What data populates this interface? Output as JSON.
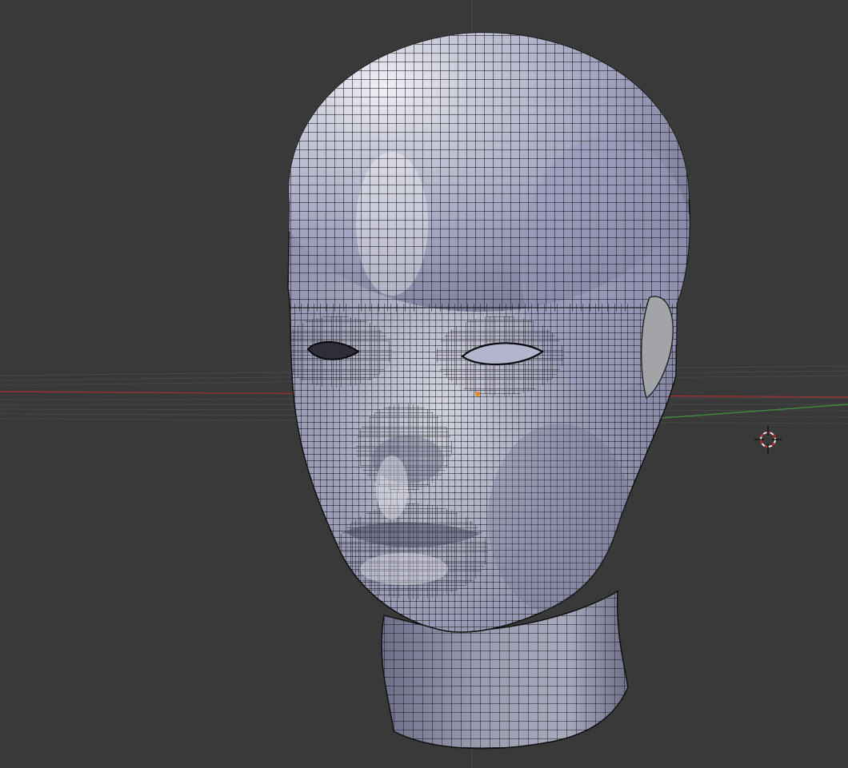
{
  "viewport": {
    "mode": "edit-mode",
    "shading": "solid",
    "object": "head-mesh",
    "show_wireframe": true
  },
  "colors": {
    "background": "#393939",
    "grid_line": "#4a4a4a",
    "x_axis": "#9a3030",
    "y_axis": "#3f8a3f",
    "mesh_light": "#e6e7f0",
    "mesh_mid": "#a7a8c4",
    "mesh_dark": "#5a5b78",
    "wire": "#0a0a0e",
    "cursor_red": "#d8262b",
    "cursor_white": "#f2f2f2",
    "selected_vertex": "#f08a20"
  },
  "icons": {
    "cursor": "3d-cursor-icon",
    "vertex": "selected-vertex-icon"
  }
}
